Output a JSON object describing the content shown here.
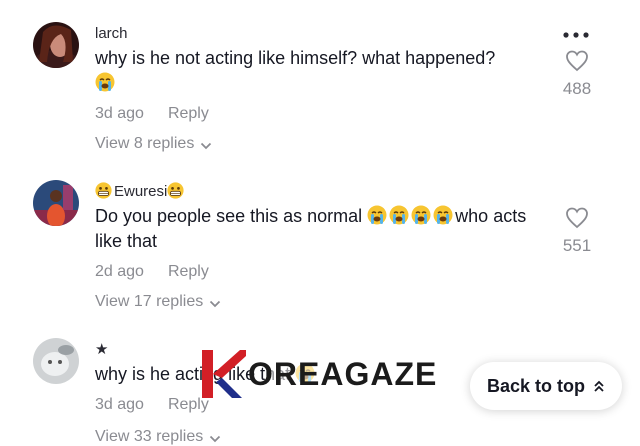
{
  "comments": [
    {
      "username": "larch",
      "text": "why is he not acting like himself? what happened?",
      "trailing_emoji": "loudly-crying-face",
      "time": "3d ago",
      "reply_label": "Reply",
      "view_replies": "View 8 replies",
      "likes": "488"
    },
    {
      "username_prefix_emoji": "grimacing-face",
      "username": "Ewuresi",
      "username_suffix_emoji": "grimacing-face",
      "text": "Do you people see this as normal",
      "emojis_mid": [
        "loudly-crying-face",
        "loudly-crying-face",
        "loudly-crying-face",
        "loudly-crying-face"
      ],
      "text_after": "who acts like that",
      "time": "2d ago",
      "reply_label": "Reply",
      "view_replies": "View 17 replies",
      "likes": "551"
    },
    {
      "username": "★",
      "text": "why is he acting like that",
      "trailing_emoji": "loudly-crying-face",
      "time": "3d ago",
      "reply_label": "Reply",
      "view_replies": "View 33 replies"
    }
  ],
  "back_to_top": "Back to top",
  "watermark": {
    "text": "OREAGAZE",
    "colors": {
      "red": "#d21f26",
      "blue": "#1f2e8a",
      "dark": "#1b1b1b"
    }
  },
  "colors": {
    "text": "#161823",
    "secondary": "#8a8b91",
    "username": "#2a2a33"
  }
}
